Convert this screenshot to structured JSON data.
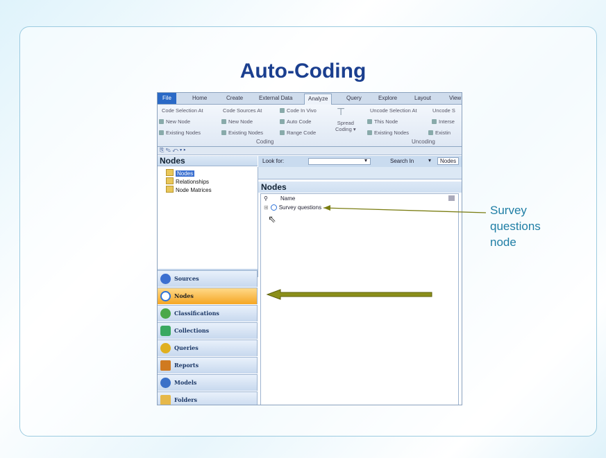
{
  "slide": {
    "title": "Auto-Coding",
    "callout": [
      "Survey",
      "questions",
      "node"
    ]
  },
  "ribbon": {
    "tabs": [
      "File",
      "Home",
      "Create",
      "External Data",
      "Analyze",
      "Query",
      "Explore",
      "Layout",
      "View"
    ],
    "active_tab": "Analyze",
    "coding_row1": [
      "Code Selection At",
      "Code Sources At",
      "Code In Vivo"
    ],
    "coding_row2": [
      "New Node",
      "New Node",
      "Auto Code"
    ],
    "coding_row3": [
      "Existing Nodes",
      "Existing Nodes",
      "Range Code"
    ],
    "spread_coding": [
      "Spread",
      "Coding"
    ],
    "coding_group": "Coding",
    "uncoding_row1": [
      "Uncode Selection At",
      "Uncode S"
    ],
    "uncoding_row2": [
      "This Node",
      "Interse"
    ],
    "uncoding_row3": [
      "Existing Nodes",
      "Existin"
    ],
    "uncoding_group": "Uncoding"
  },
  "quick_access": "⎘ ✎ ↶ ▾ ▸",
  "navigation": {
    "header": "Nodes",
    "tree": [
      "Nodes",
      "Relationships",
      "Node Matrices"
    ],
    "buttons": [
      "Sources",
      "Nodes",
      "Classifications",
      "Collections",
      "Queries",
      "Reports",
      "Models",
      "Folders"
    ],
    "active_button": "Nodes",
    "button_colors": [
      "#3b6fd0",
      "#2d72d8",
      "#4aa84a",
      "#3aa860",
      "#e0b020",
      "#d07a20",
      "#3a70c8",
      "#e6b84a"
    ]
  },
  "search": {
    "look_for_label": "Look for:",
    "look_for_value": "",
    "search_in_label": "Search In",
    "search_in_value": "Nodes"
  },
  "node_list": {
    "title": "Nodes",
    "column_name": "Name",
    "rows": [
      {
        "name": "Survey questions"
      }
    ]
  },
  "colors": {
    "title": "#1b3f8f",
    "callout": "#1f7ea5",
    "arrow": "#7a7d12",
    "arrow_fill": "#8b8f1a"
  }
}
